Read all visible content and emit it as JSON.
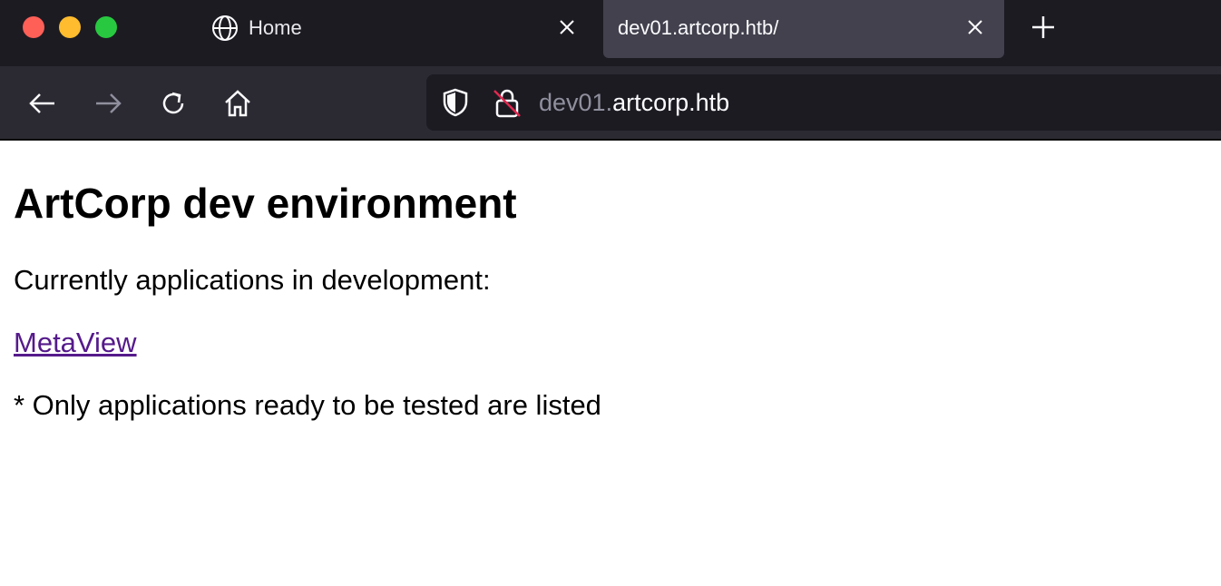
{
  "browser": {
    "tabs": [
      {
        "label": "Home",
        "icon": "globe-icon",
        "active": false
      },
      {
        "label": "dev01.artcorp.htb/",
        "active": true
      }
    ],
    "url": {
      "subdomain": "dev01.",
      "domain": "artcorp.htb"
    },
    "colors": {
      "tabstrip": "#1c1b22",
      "toolbar": "#2b2a33",
      "active_tab": "#42414d",
      "traffic_red": "#fe5f57",
      "traffic_yellow": "#febc2e",
      "traffic_green": "#28c840"
    }
  },
  "page": {
    "heading": "ArtCorp dev environment",
    "intro": "Currently applications in development:",
    "link_text": "MetaView",
    "note": "* Only applications ready to be tested are listed",
    "colors": {
      "link": "#551a8b",
      "text": "#000000"
    }
  }
}
